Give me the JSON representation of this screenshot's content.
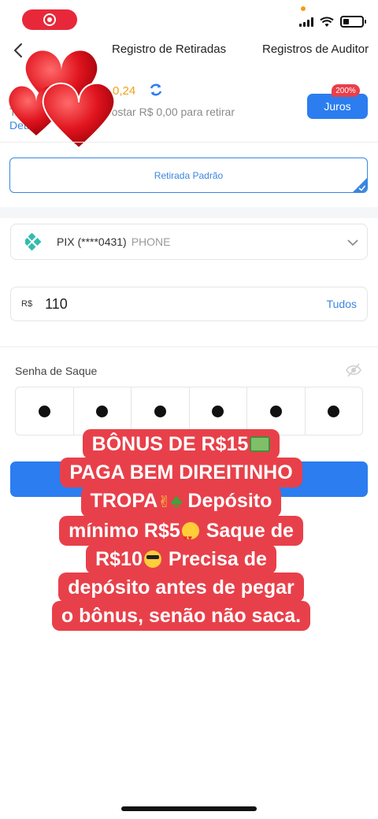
{
  "nav": {
    "tabs": [
      "Registro de Retiradas",
      "Registros de Auditoria"
    ]
  },
  "balance": {
    "value": "0,24",
    "note_prefix": "Te",
    "note": "ostar R$ 0,00 para retirar",
    "details_link": "Deti",
    "juros_label": "Juros",
    "juros_badge": "200%"
  },
  "withdraw_type": {
    "label": "Retirada Padrão"
  },
  "pix": {
    "label": "PIX (****0431)",
    "type": "PHONE"
  },
  "amount": {
    "currency": "R$",
    "value": "110",
    "all_label": "Tudos"
  },
  "password": {
    "label": "Senha de Saque",
    "digits": 6
  },
  "overlay": {
    "lines": [
      "BÔNUS DE R$15",
      "PAGA BEM DIREITINHO",
      "TROPA",
      "Depósito",
      "mínimo R$5",
      "Saque de",
      "R$10",
      "Precisa de",
      "depósito antes de pegar",
      "o bônus, senão não saca."
    ]
  },
  "colors": {
    "accent": "#2b7df0",
    "overlay_bg": "#e8404a",
    "balance": "#f0a21a",
    "record_pill": "#e8283a"
  },
  "icons": [
    "record-icon",
    "signal-icon",
    "wifi-icon",
    "battery-icon",
    "back-icon",
    "refresh-icon",
    "pix-icon",
    "chevron-down-icon",
    "eye-off-icon",
    "check-icon"
  ]
}
